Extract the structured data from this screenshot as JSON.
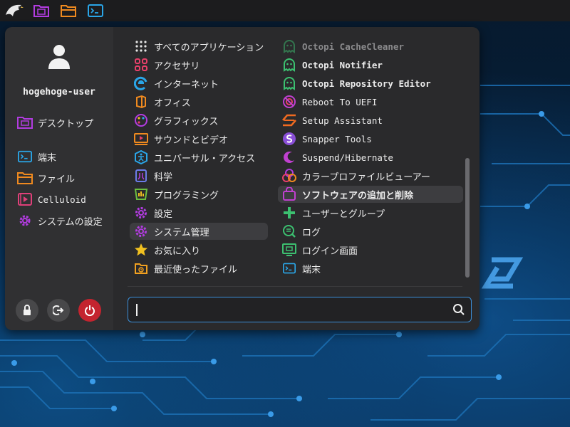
{
  "topbar": {
    "items": [
      "eagle-logo-icon",
      "file-manager-purple-icon",
      "folder-orange-icon",
      "terminal-icon"
    ]
  },
  "user": {
    "name": "hogehoge-user"
  },
  "sidebar": {
    "items": [
      {
        "label": "デスクトップ",
        "icon": "desktop-folder-icon"
      },
      {
        "label": "端末",
        "icon": "terminal-icon"
      },
      {
        "label": "ファイル",
        "icon": "folder-icon"
      },
      {
        "label": "Celluloid",
        "icon": "video-player-icon"
      },
      {
        "label": "システムの設定",
        "icon": "settings-gear-icon"
      }
    ],
    "actions": [
      "lock-icon",
      "logout-icon",
      "power-icon"
    ]
  },
  "categories": [
    {
      "label": "すべてのアプリケーション",
      "icon": "grid-icon"
    },
    {
      "label": "アクセサリ",
      "icon": "accessories-icon"
    },
    {
      "label": "インターネット",
      "icon": "internet-icon"
    },
    {
      "label": "オフィス",
      "icon": "office-icon"
    },
    {
      "label": "グラフィックス",
      "icon": "graphics-icon"
    },
    {
      "label": "サウンドとビデオ",
      "icon": "multimedia-icon"
    },
    {
      "label": "ユニバーサル・アクセス",
      "icon": "accessibility-icon"
    },
    {
      "label": "科学",
      "icon": "science-icon"
    },
    {
      "label": "プログラミング",
      "icon": "programming-icon"
    },
    {
      "label": "設定",
      "icon": "settings-icon"
    },
    {
      "label": "システム管理",
      "icon": "system-admin-icon"
    },
    {
      "label": "お気に入り",
      "icon": "favorites-star-icon"
    },
    {
      "label": "最近使ったファイル",
      "icon": "recent-files-icon"
    }
  ],
  "apps": [
    {
      "label": "Octopi CacheCleaner",
      "icon": "octopi-icon"
    },
    {
      "label": "Octopi Notifier",
      "icon": "octopi-icon"
    },
    {
      "label": "Octopi Repository Editor",
      "icon": "octopi-icon"
    },
    {
      "label": "Reboot To UEFI",
      "icon": "reboot-uefi-icon"
    },
    {
      "label": "Setup Assistant",
      "icon": "setup-assistant-icon"
    },
    {
      "label": "Snapper Tools",
      "icon": "snapper-icon"
    },
    {
      "label": "Suspend/Hibernate",
      "icon": "moon-icon"
    },
    {
      "label": "カラープロファイルビューアー",
      "icon": "color-profile-icon"
    },
    {
      "label": "ソフトウェアの追加と削除",
      "icon": "software-bag-icon"
    },
    {
      "label": "ユーザーとグループ",
      "icon": "users-groups-icon"
    },
    {
      "label": "ログ",
      "icon": "log-viewer-icon"
    },
    {
      "label": "ログイン画面",
      "icon": "login-screen-icon"
    },
    {
      "label": "端末",
      "icon": "terminal-icon"
    }
  ],
  "search": {
    "value": "",
    "placeholder": ""
  },
  "colors": {
    "accent": "#3b8fd9",
    "power": "#c4242f",
    "menu_bg": "#2a2a2c"
  }
}
